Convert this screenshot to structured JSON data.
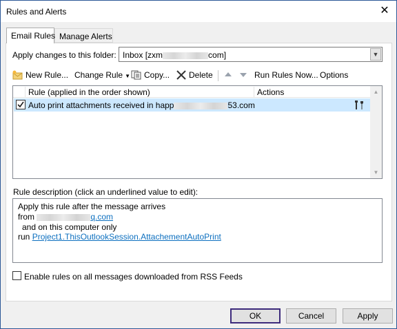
{
  "window": {
    "title": "Rules and Alerts",
    "close_glyph": "✕"
  },
  "tabs": [
    {
      "label": "Email Rules",
      "active": true
    },
    {
      "label": "Manage Alerts",
      "active": false
    }
  ],
  "folder": {
    "label": "Apply changes to this folder:",
    "value_prefix": "Inbox [zxm",
    "value_suffix": "com]"
  },
  "toolbar": {
    "new_rule": "New Rule...",
    "change_rule": "Change Rule",
    "copy": "Copy...",
    "delete": "Delete",
    "run_rules_now": "Run Rules Now...",
    "options": "Options"
  },
  "rule_list": {
    "columns": [
      "Rule (applied in the order shown)",
      "Actions"
    ],
    "rows": [
      {
        "checked": true,
        "name_prefix": "Auto print attachments received in happ",
        "name_suffix": "53.com",
        "action_icon": "tools-icon"
      }
    ]
  },
  "description": {
    "label": "Rule description (click an underlined value to edit):",
    "line1": "Apply this rule after the message arrives",
    "line2_prefix": "from",
    "line2_link_suffix": "q.com",
    "line3": "and on this computer only",
    "line4_prefix": "run",
    "line4_link": "Project1.ThisOutlookSession.AttachementAutoPrint"
  },
  "rss": {
    "label": "Enable rules on all messages downloaded from RSS Feeds",
    "checked": false
  },
  "buttons": {
    "ok": "OK",
    "cancel": "Cancel",
    "apply": "Apply"
  },
  "colors": {
    "selection": "#cce8ff",
    "link": "#0c6fbf",
    "window_border": "#2b5797"
  }
}
